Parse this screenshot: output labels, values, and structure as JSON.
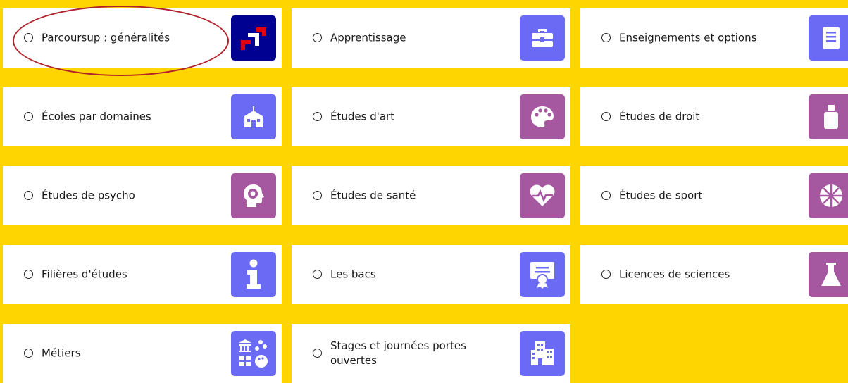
{
  "colors": {
    "background": "#FFD500",
    "blue_tile": "#6A6AF4",
    "purple_tile": "#A558A0",
    "navy_tile": "#000091",
    "highlight_oval": "#B0232B"
  },
  "cards": [
    {
      "label": "Parcoursup : généralités",
      "icon": "parcoursup-logo-icon",
      "selected": false
    },
    {
      "label": "Apprentissage",
      "icon": "briefcase-icon",
      "selected": false
    },
    {
      "label": "Enseignements et options",
      "icon": "notebook-icon",
      "selected": false
    },
    {
      "label": "Écoles par domaines",
      "icon": "school-building-icon",
      "selected": false
    },
    {
      "label": "Études d'art",
      "icon": "palette-icon",
      "selected": false
    },
    {
      "label": "Études de droit",
      "icon": "law-book-icon",
      "selected": false
    },
    {
      "label": "Études de psycho",
      "icon": "head-gear-icon",
      "selected": false
    },
    {
      "label": "Études de santé",
      "icon": "heart-pulse-icon",
      "selected": false
    },
    {
      "label": "Études de sport",
      "icon": "basketball-icon",
      "selected": false
    },
    {
      "label": "Filières d'études",
      "icon": "info-icon",
      "selected": false
    },
    {
      "label": "Les bacs",
      "icon": "diploma-icon",
      "selected": false
    },
    {
      "label": "Licences de sciences",
      "icon": "flask-icon",
      "selected": false
    },
    {
      "label": "Métiers",
      "icon": "jobs-collage-icon",
      "selected": false
    },
    {
      "label": "Stages et journées portes ouvertes",
      "icon": "buildings-icon",
      "selected": false
    }
  ]
}
